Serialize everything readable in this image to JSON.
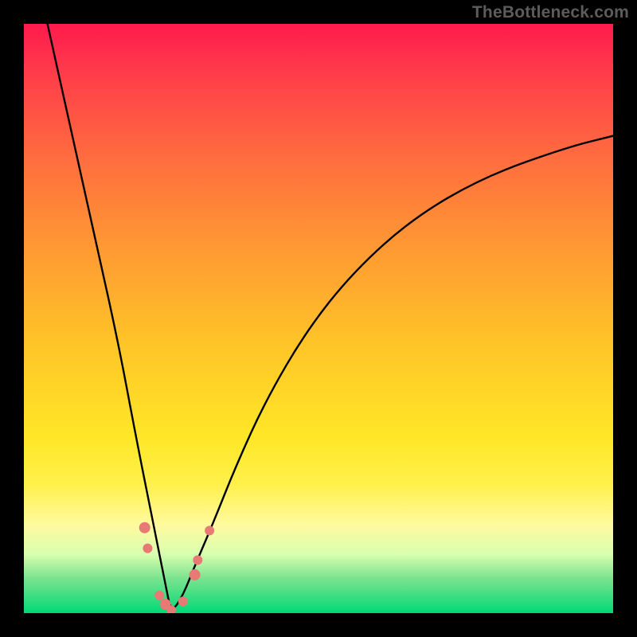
{
  "watermark": "TheBottleneck.com",
  "colors": {
    "page_bg": "#000000",
    "curve_stroke": "#000000",
    "marker_fill": "#e77a74",
    "gradient_stops": [
      "#ff1a4d",
      "#ff3b4a",
      "#ff6a3f",
      "#ff9933",
      "#ffc627",
      "#ffe727",
      "#fff04a",
      "#fffa9e",
      "#d9ffb0",
      "#7de38f",
      "#00d977"
    ]
  },
  "chart_data": {
    "type": "line",
    "title": "",
    "xlabel": "",
    "ylabel": "",
    "xlim": [
      0,
      100
    ],
    "ylim": [
      0,
      100
    ],
    "note": "X positions are approximate normalized percentages of the plot width. Y values are percentage height from bottom (0 = bottom green band, 100 = top). The curve is a V-shaped bottleneck curve with its minimum near x≈25 at y≈0, rising steeply toward both sides.",
    "series": [
      {
        "name": "bottleneck-curve",
        "x": [
          4,
          8,
          12,
          16,
          19,
          22,
          24,
          25,
          27,
          29,
          32,
          36,
          41,
          48,
          56,
          66,
          78,
          92,
          100
        ],
        "values": [
          100,
          82,
          64,
          46,
          30,
          15,
          5,
          0,
          3,
          8,
          15,
          25,
          36,
          48,
          58,
          67,
          74,
          79,
          81
        ]
      }
    ],
    "markers": [
      {
        "x": 20.5,
        "y": 14.5
      },
      {
        "x": 21.0,
        "y": 11.0
      },
      {
        "x": 23.0,
        "y": 3.0
      },
      {
        "x": 24.0,
        "y": 1.5
      },
      {
        "x": 25.0,
        "y": 0.5
      },
      {
        "x": 27.0,
        "y": 2.0
      },
      {
        "x": 29.0,
        "y": 6.5
      },
      {
        "x": 29.5,
        "y": 9.0
      },
      {
        "x": 31.5,
        "y": 14.0
      }
    ]
  }
}
